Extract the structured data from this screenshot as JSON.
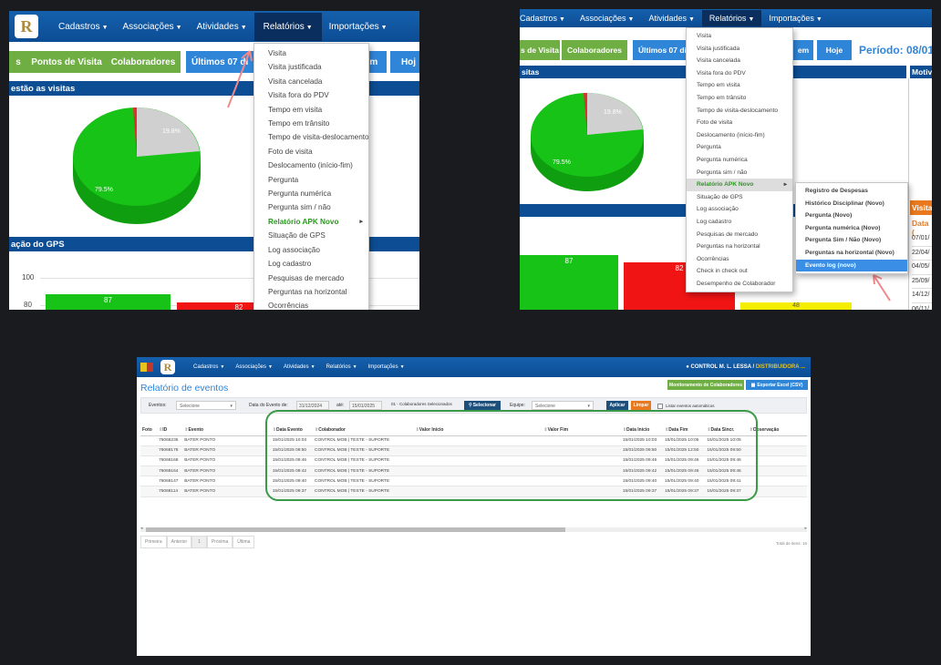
{
  "nav": {
    "items": [
      "Cadastros",
      "Associações",
      "Atividades",
      "Relatórios",
      "Importações"
    ],
    "active": "Relatórios"
  },
  "screen1": {
    "tabs": [
      "Pontos de Visita",
      "Colaboradores",
      "Últimos 07 di",
      "em",
      "Hoj"
    ],
    "tab_left_fragment": "s",
    "section1": "estão as visitas",
    "section2": "ação do GPS",
    "pie_labels": [
      "19.8%",
      "79.5%"
    ],
    "bar_axis": [
      "100",
      "80"
    ],
    "bar_values": [
      "87",
      "82"
    ],
    "menu": [
      "Visita",
      "Visita justificada",
      "Visita cancelada",
      "Visita fora do PDV",
      "Tempo em visita",
      "Tempo em trânsito",
      "Tempo de visita-deslocamento",
      "Foto de visita",
      "Deslocamento (início-fim)",
      "Pergunta",
      "Pergunta numérica",
      "Pergunta sim / não",
      "Relatório APK Novo",
      "Situação de GPS",
      "Log associação",
      "Log cadastro",
      "Pesquisas de mercado",
      "Perguntas na horizontal",
      "Ocorrências"
    ]
  },
  "screen2": {
    "tabs": [
      "s de Visita",
      "Colaboradores",
      "Últimos 07 di",
      "em",
      "Hoje"
    ],
    "periodo": "Período: 08/01/2",
    "section1": "sitas",
    "motiv": "Motiv",
    "pie_labels": [
      "19.8%",
      "79.5%"
    ],
    "bar_values": [
      "87",
      "82",
      "48"
    ],
    "visita_title": "Visita",
    "visita_head": "Data (",
    "visita_dates": [
      "07/01/",
      "22/04/",
      "04/05/",
      "25/09/",
      "14/12/",
      "06/11/"
    ],
    "menu": [
      "Visita",
      "Visita justificada",
      "Visita cancelada",
      "Visita fora do PDV",
      "Tempo em visita",
      "Tempo em trânsito",
      "Tempo de visita-deslocamento",
      "Foto de visita",
      "Deslocamento (início-fim)",
      "Pergunta",
      "Pergunta numérica",
      "Pergunta sim / não",
      "Relatório APK Novo",
      "Situação de GPS",
      "Log associação",
      "Log cadastro",
      "Pesquisas de mercado",
      "Perguntas na horizontal",
      "Ocorrências",
      "Check in check out",
      "Desempenho de Colaborador"
    ],
    "submenu": [
      "Registro de Despesas",
      "Histórico Disciplinar (Novo)",
      "Pergunta (Novo)",
      "Pergunta numérica (Novo)",
      "Pergunta Sim / Não (Novo)",
      "Perguntas na horizontal (Novo)",
      "Evento log (novo)"
    ]
  },
  "screen3": {
    "user": "CONTROL M. L. LESSA /",
    "user_company": "DISTRIBUIDORA ...",
    "title": "Relatório de eventos",
    "btn_monitor": "Monitoramento de Colaboradores",
    "btn_export": "Exportar Excel (CSV)",
    "filters": {
      "eventos_label": "Eventos:",
      "eventos_value": "Selecione",
      "data_label": "Data do Evento de:",
      "data_de": "31/12/2024",
      "ate_label": "até:",
      "data_ate": "15/01/2025",
      "colab_selected": "01 - Colaboradores Selecionados",
      "selecionar": "Selecionar",
      "equipe_label": "Equipe:",
      "equipe_value": "Selecione",
      "aplicar": "Aplicar",
      "limpar": "Limpar",
      "checkbox": "Listar eventos automáticos"
    },
    "columns": [
      "Foto",
      "ID",
      "Evento",
      "Data Evento",
      "Colaborador",
      "Valor Início",
      "Valor Fim",
      "Data Início",
      "Data Fim",
      "Data Sincr.",
      "Observação"
    ],
    "rows": [
      [
        "",
        "76068236",
        "BATER PONTO",
        "15/01/2025 10:03",
        "CONTROL MOB | TESTE - SUPORTE",
        "",
        "",
        "15/01/2025 10:03",
        "15/01/2025 10:05",
        "15/01/2025 10:05",
        ""
      ],
      [
        "",
        "76068178",
        "BATER PONTO",
        "15/01/2025 09:50",
        "CONTROL MOB | TESTE - SUPORTE",
        "",
        "",
        "15/01/2025 09:50",
        "15/01/2025 12:50",
        "15/01/2025 09:50",
        ""
      ],
      [
        "",
        "76068168",
        "BATER PONTO",
        "15/01/2025 09:46",
        "CONTROL MOB | TESTE - SUPORTE",
        "",
        "",
        "15/01/2025 09:46",
        "15/01/2025 09:46",
        "15/01/2025 09:46",
        ""
      ],
      [
        "",
        "76068164",
        "BATER PONTO",
        "15/01/2025 09:42",
        "CONTROL MOB | TESTE - SUPORTE",
        "",
        "",
        "15/01/2025 09:42",
        "15/01/2025 09:46",
        "15/01/2025 09:46",
        ""
      ],
      [
        "",
        "76068147",
        "BATER PONTO",
        "15/01/2025 09:40",
        "CONTROL MOB | TESTE - SUPORTE",
        "",
        "",
        "15/01/2025 09:40",
        "15/01/2025 09:40",
        "15/01/2025 09:41",
        ""
      ],
      [
        "",
        "75068114",
        "BATER PONTO",
        "15/01/2025 09:37",
        "CONTROL MOB | TESTE - SUPORTE",
        "",
        "",
        "15/01/2025 09:37",
        "15/01/2025 09:37",
        "15/01/2025 09:37",
        ""
      ]
    ],
    "pagination": [
      "Primeira",
      "Anterior",
      "1",
      "Próxima",
      "Última"
    ],
    "total": "Total de itens: 16"
  },
  "colors": {
    "nav": "#0c4d94",
    "green_btn": "#6fae43",
    "blue_btn": "#2f86d9",
    "pie_green": "#16c316",
    "pie_gray": "#d0d0d0",
    "bar_red": "#f01414",
    "bar_yellow": "#f6ee00",
    "highlight": "#3a8ee6",
    "annotation": "#3a9a48",
    "arrow": "#f08a8a"
  }
}
